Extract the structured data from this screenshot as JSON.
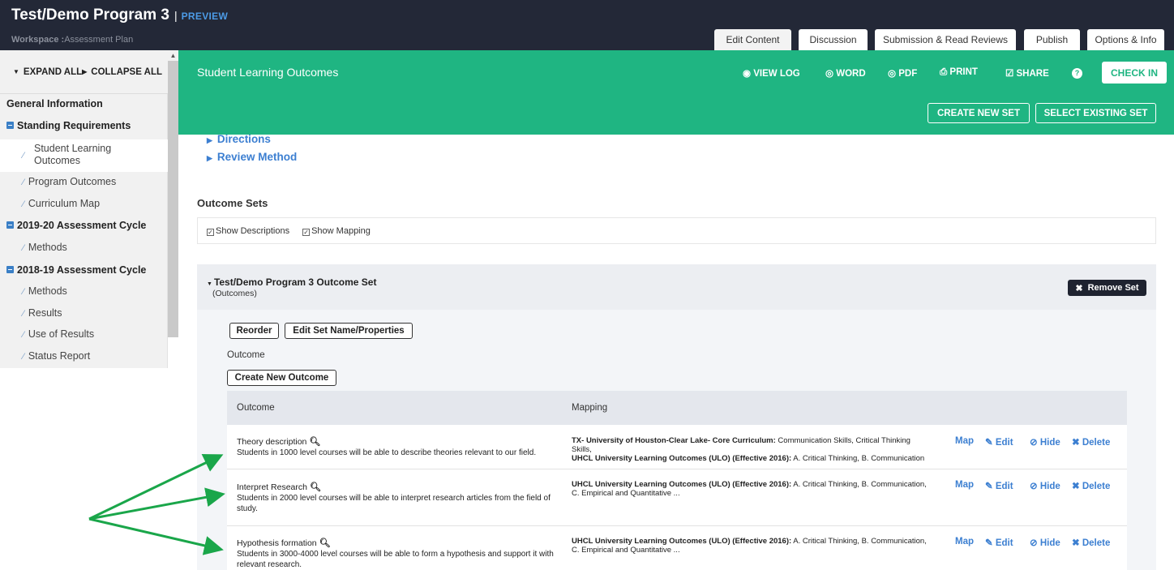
{
  "header": {
    "title": "Test/Demo Program 3",
    "separator": "|",
    "preview": "PREVIEW",
    "workspace_label": "Workspace :",
    "workspace_value": "Assessment Plan"
  },
  "tabs": [
    {
      "label": "Edit Content",
      "active": true
    },
    {
      "label": "Discussion"
    },
    {
      "label": "Submission & Read Reviews"
    },
    {
      "label": "Publish"
    },
    {
      "label": "Options & Info"
    }
  ],
  "sidebar": {
    "expand_all": "EXPAND ALL",
    "collapse_all": "COLLAPSE ALL",
    "items": [
      {
        "label": "General Information",
        "type": "head"
      },
      {
        "label": "Standing Requirements",
        "type": "group"
      },
      {
        "label": "Student Learning Outcomes",
        "type": "sub",
        "active": true
      },
      {
        "label": "Program Outcomes",
        "type": "sub"
      },
      {
        "label": "Curriculum Map",
        "type": "sub"
      },
      {
        "label": "2019-20 Assessment Cycle",
        "type": "group"
      },
      {
        "label": "Methods",
        "type": "sub"
      },
      {
        "label": "2018-19 Assessment Cycle",
        "type": "group"
      },
      {
        "label": "Methods",
        "type": "sub"
      },
      {
        "label": "Results",
        "type": "sub"
      },
      {
        "label": "Use of Results",
        "type": "sub"
      },
      {
        "label": "Status Report",
        "type": "sub"
      }
    ]
  },
  "toolbar": {
    "section_title": "Student Learning Outcomes",
    "view_log": "VIEW LOG",
    "word": "WORD",
    "pdf": "PDF",
    "print": "PRINT",
    "share": "SHARE",
    "help": "?",
    "check_in": "CHECK IN",
    "create_new_set": "CREATE NEW SET",
    "select_existing_set": "SELECT EXISTING SET"
  },
  "content": {
    "directions": "Directions",
    "review_method": "Review Method",
    "outcome_sets_title": "Outcome Sets",
    "show_descriptions": "Show Descriptions",
    "show_mapping": "Show Mapping",
    "set_title": "Test/Demo Program 3 Outcome Set",
    "set_subtitle": "(Outcomes)",
    "remove_set": "Remove Set",
    "reorder": "Reorder",
    "edit_set_name": "Edit Set Name/Properties",
    "outcome_label": "Outcome",
    "create_new_outcome": "Create New Outcome"
  },
  "table": {
    "col_outcome": "Outcome",
    "col_mapping": "Mapping",
    "actions": {
      "map": "Map",
      "edit": "Edit",
      "hide": "Hide",
      "delete": "Delete"
    },
    "rows": [
      {
        "title": "Theory description",
        "desc": "Students in 1000 level courses will be able to describe theories relevant to our field.",
        "map1_b": "TX- University of Houston-Clear Lake- Core Curriculum:",
        "map1": " Communication Skills, Critical Thinking Skills,",
        "map2_b": "UHCL University Learning Outcomes (ULO) (Effective 2016):",
        "map2": " A. Critical Thinking, B. Communication"
      },
      {
        "title": "Interpret Research",
        "desc": "Students in 2000 level courses will be able to interpret research articles from the field of study.",
        "map1_b": "UHCL University Learning Outcomes (ULO) (Effective 2016):",
        "map1": " A. Critical Thinking, B. Communication, C. Empirical and Quantitative ..."
      },
      {
        "title": "Hypothesis formation",
        "desc": "Students in 3000-4000 level courses will be able to form a hypothesis and support it with relevant research.",
        "map1_b": "UHCL University Learning Outcomes (ULO) (Effective 2016):",
        "map1": " A. Critical Thinking, B. Communication, C. Empirical and Quantitative ..."
      }
    ]
  },
  "colors": {
    "topbar": "#232837",
    "accent_green": "#1fb582",
    "link_blue": "#3c7fd1",
    "arrow_green": "#1aa64a"
  }
}
